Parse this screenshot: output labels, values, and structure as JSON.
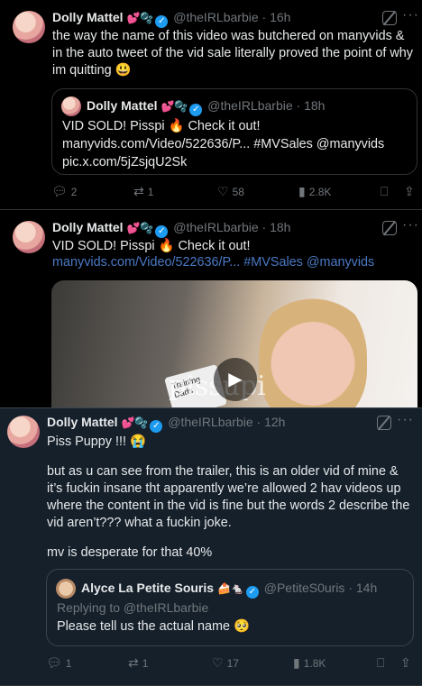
{
  "tweets": [
    {
      "name": "Dolly Mattel",
      "name_emojis": "💕🫧",
      "handle": "@theIRLbarbie",
      "time": "16h",
      "text": "the way the name of this video was butchered on manyvids & in the auto tweet of the vid sale literally proved the point of why im quitting 😃",
      "quote": {
        "name": "Dolly Mattel",
        "name_emojis": "💕🫧",
        "handle": "@theIRLbarbie",
        "time": "18h",
        "line1": "VID SOLD! Pisspi 🔥 Check it out!",
        "line2": "manyvids.com/Video/522636/P... #MVSales @manyvids",
        "line3": "pic.x.com/5jZsjqU2Sk"
      },
      "actions": {
        "replies": "2",
        "retweets": "1",
        "likes": "58",
        "views": "2.8K"
      }
    },
    {
      "name": "Dolly Mattel",
      "name_emojis": "💕🫧",
      "handle": "@theIRLbarbie",
      "time": "18h",
      "line1": "VID SOLD! Pisspi 🔥 Check it out!",
      "line2": "manyvids.com/Video/522636/P... #MVSales @manyvids",
      "media": {
        "watermark": "pissupi",
        "package_text": "Training Dads"
      }
    },
    {
      "name": "Dolly Mattel",
      "name_emojis": "💕🫧",
      "handle": "@theIRLbarbie",
      "time": "12h",
      "para1": "Piss Puppy !!! 😭",
      "para2": "but as u can see from the trailer, this is an older vid of mine & it’s fuckin insane tht apparently we’re allowed 2 hav videos up where the content in the vid is fine but the words 2 describe the vid aren’t??? what a fuckin joke.",
      "para3": "mv is desperate for that 40%",
      "quote": {
        "name": "Alyce La Petite Souris",
        "name_emojis": "🍰🐁",
        "handle": "@PetiteS0uris",
        "time": "14h",
        "replying": "Replying to @theIRLbarbie",
        "text": "Please tell us the actual name 🥺"
      },
      "actions": {
        "replies": "1",
        "retweets": "1",
        "likes": "17",
        "views": "1.8K"
      }
    }
  ],
  "icons": [
    "reply-icon",
    "retweet-icon",
    "like-icon",
    "views-icon",
    "bookmark-icon",
    "share-icon",
    "grok-icon",
    "more-icon",
    "verified-badge"
  ],
  "colors": {
    "background": "#000000",
    "dim_background": "#15202b",
    "text": "#e7e9ea",
    "secondary": "#71767b",
    "link": "#4a79c4",
    "verified": "#1d9bf0"
  }
}
